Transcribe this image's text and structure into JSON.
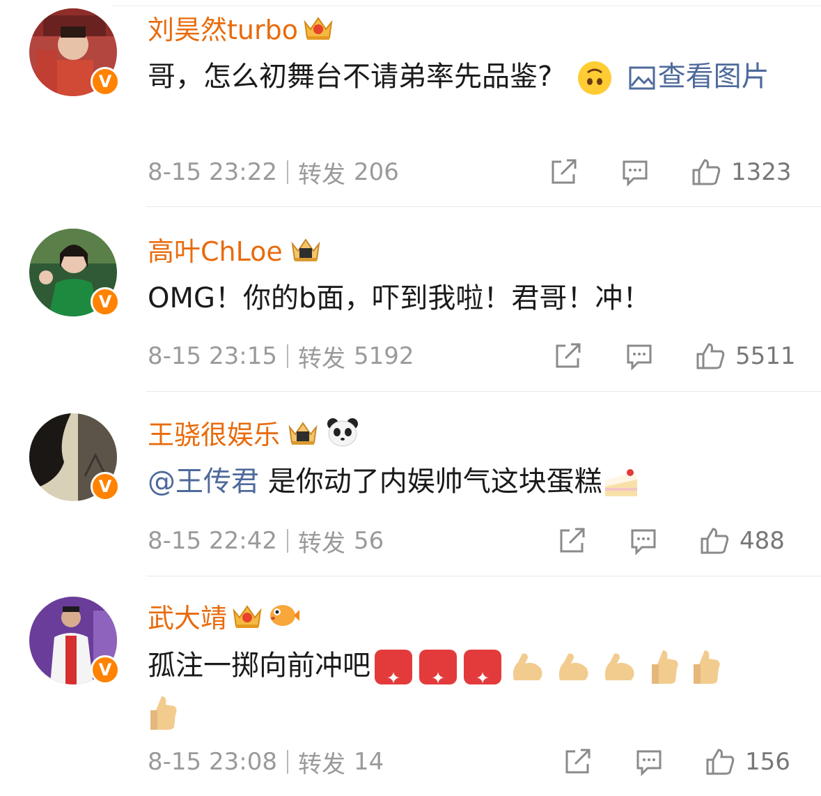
{
  "comments": [
    {
      "name": "刘昊然turbo",
      "text": "哥，怎么初舞台不请弟率先品鉴?",
      "link": "查看图片",
      "time": "8-15 23:22",
      "repost_label": "转发",
      "repost_count": "206",
      "likes": "1323"
    },
    {
      "name": "高叶ChLoe",
      "text": "OMG！你的b面，吓到我啦！君哥！冲！",
      "time": "8-15 23:15",
      "repost_label": "转发",
      "repost_count": "5192",
      "likes": "5511"
    },
    {
      "name": "王骁很娱乐",
      "mention": "@王传君",
      "text": " 是你动了内娱帅气这块蛋糕",
      "time": "8-15 22:42",
      "repost_label": "转发",
      "repost_count": "56",
      "likes": "488"
    },
    {
      "name": "武大靖",
      "text": "孤注一掷向前冲吧",
      "time": "8-15 23:08",
      "repost_label": "转发",
      "repost_count": "14",
      "likes": "156"
    }
  ],
  "badge_letter": "V",
  "colors": {
    "name": "#e86b0c",
    "link": "#4e6a9b",
    "meta": "#9a9a9a",
    "badge": "#ff8200"
  }
}
